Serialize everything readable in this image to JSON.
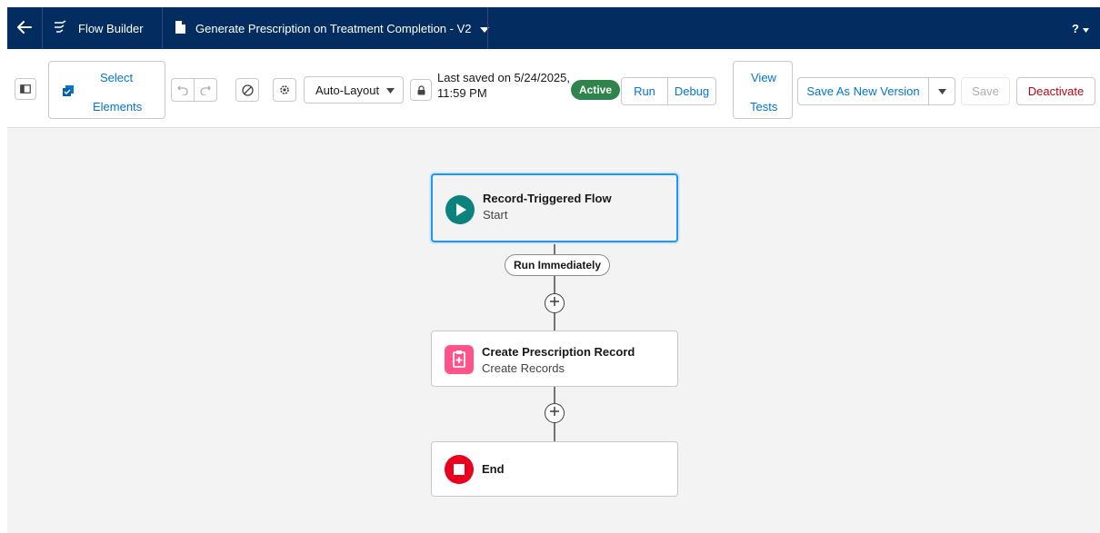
{
  "topbar": {
    "app_name": "Flow Builder",
    "flow_title": "Generate Prescription on Treatment Completion - V2",
    "help_label": "?"
  },
  "toolbar": {
    "select_elements_line1": "Select",
    "select_elements_line2": "Elements",
    "layout_select": "Auto-Layout",
    "last_saved_line1": "Last saved on 5/24/2025,",
    "last_saved_line2": "11:59 PM",
    "status_badge": "Active",
    "run_label": "Run",
    "debug_label": "Debug",
    "view_tests_line1": "View",
    "view_tests_line2": "Tests",
    "save_new_version_label": "Save As New Version",
    "save_label": "Save",
    "deactivate_label": "Deactivate"
  },
  "canvas": {
    "start_node": {
      "title": "Record-Triggered Flow",
      "subtitle": "Start"
    },
    "path_label": "Run Immediately",
    "create_node": {
      "title": "Create Prescription Record",
      "subtitle": "Create Records"
    },
    "end_node": {
      "title": "End"
    }
  },
  "colors": {
    "topbar": "#032d60",
    "brand_blue": "#0176d3",
    "active_green": "#2e844a",
    "start_icon": "#0b827c",
    "create_icon": "#ff538a",
    "end_icon": "#ea001e",
    "deactivate_red": "#ba0517"
  },
  "icons": [
    "back-arrow-icon",
    "flow-builder-icon",
    "file-icon",
    "chevron-down-icon",
    "help-icon",
    "toggle-panel-icon",
    "select-elements-icon",
    "undo-icon",
    "redo-icon",
    "no-entry-icon",
    "settings-icon",
    "lock-icon",
    "play-icon",
    "create-records-icon",
    "stop-icon",
    "add-icon"
  ]
}
